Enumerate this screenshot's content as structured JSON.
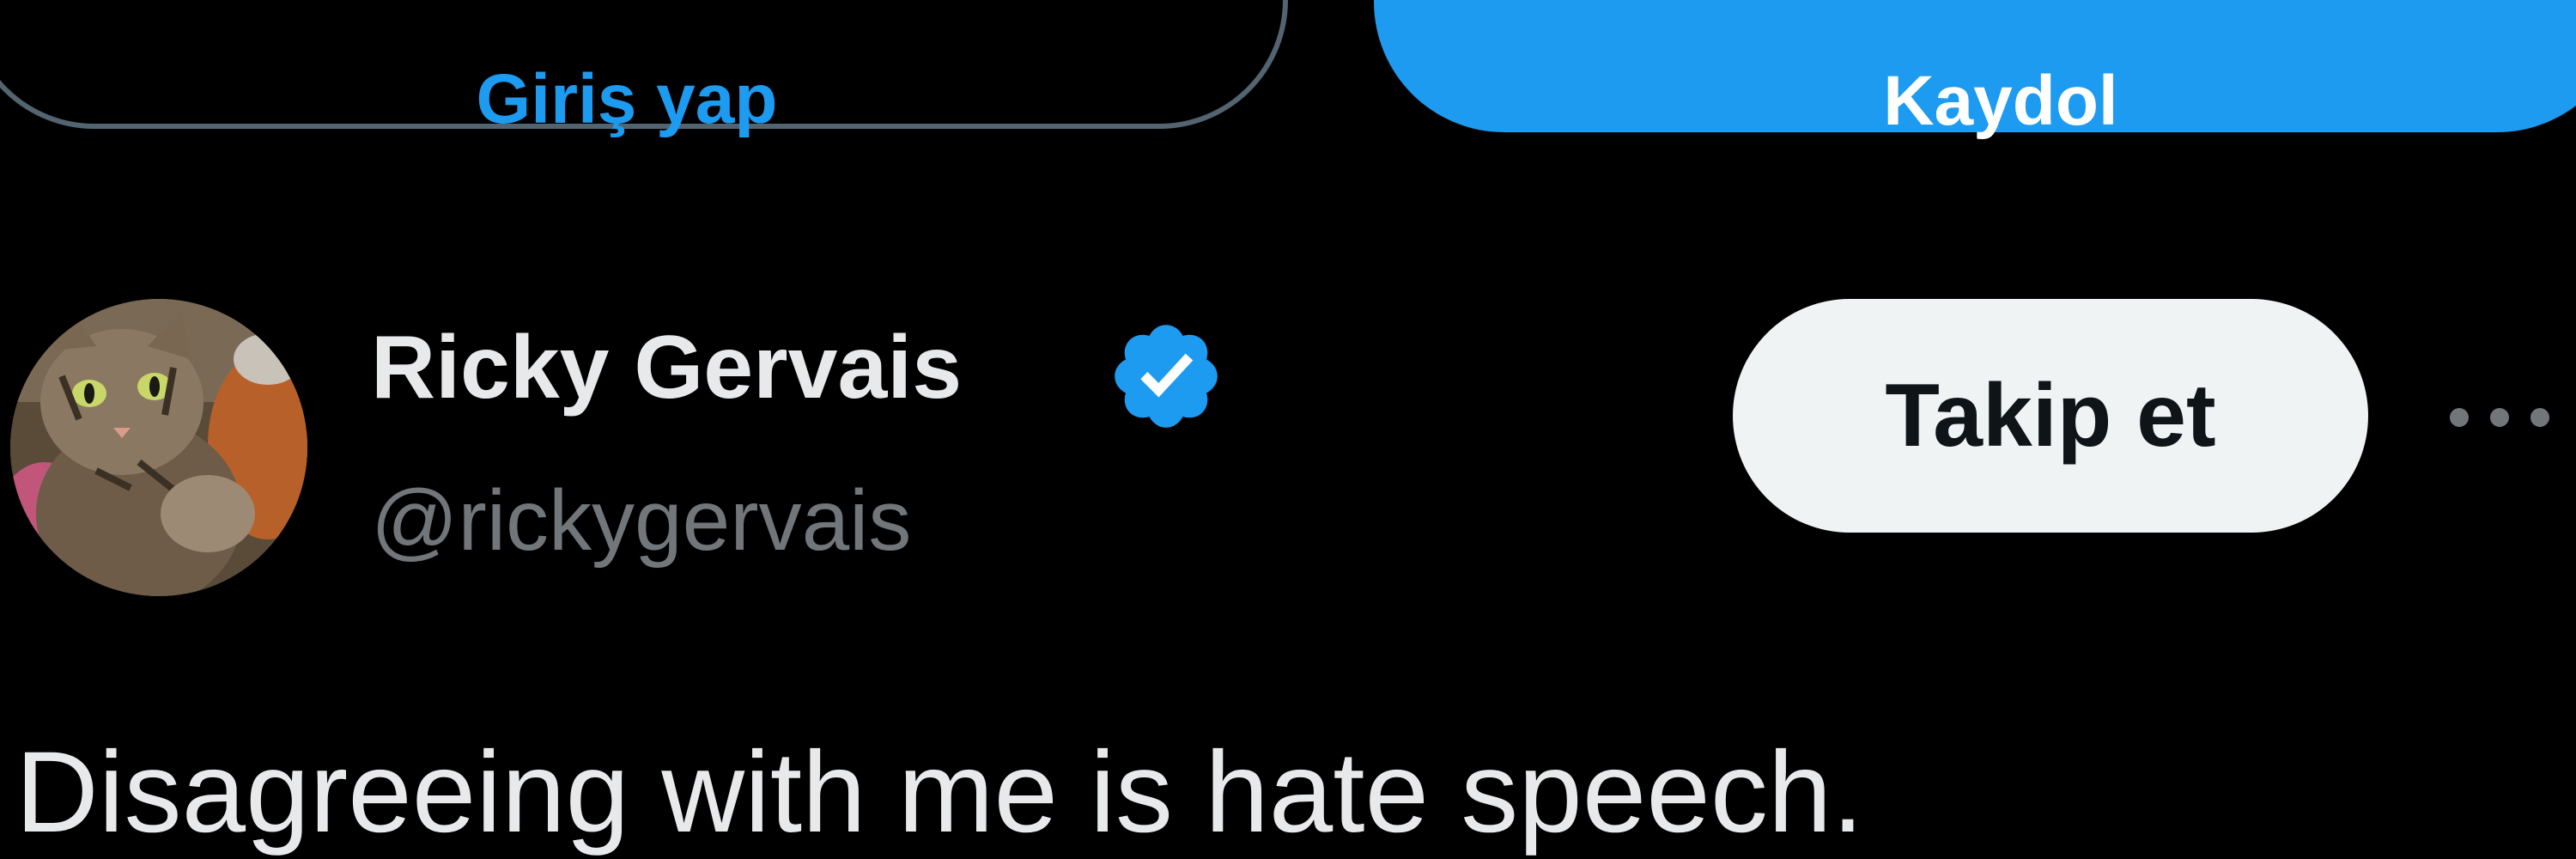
{
  "auth": {
    "login_label": "Giriş yap",
    "signup_label": "Kaydol"
  },
  "tweet": {
    "author": {
      "display_name": "Ricky Gervais",
      "handle": "@rickygervais",
      "verified": true
    },
    "follow_label": "Takip et",
    "text": "Disagreeing with me is hate speech."
  },
  "icons": {
    "verified": "verified-badge-icon",
    "more": "more-options-icon"
  },
  "colors": {
    "background": "#000000",
    "accent": "#1d9bf0",
    "primary_text": "#e7e9ea",
    "secondary_text": "#71767b",
    "follow_button_bg": "#eff3f4"
  }
}
